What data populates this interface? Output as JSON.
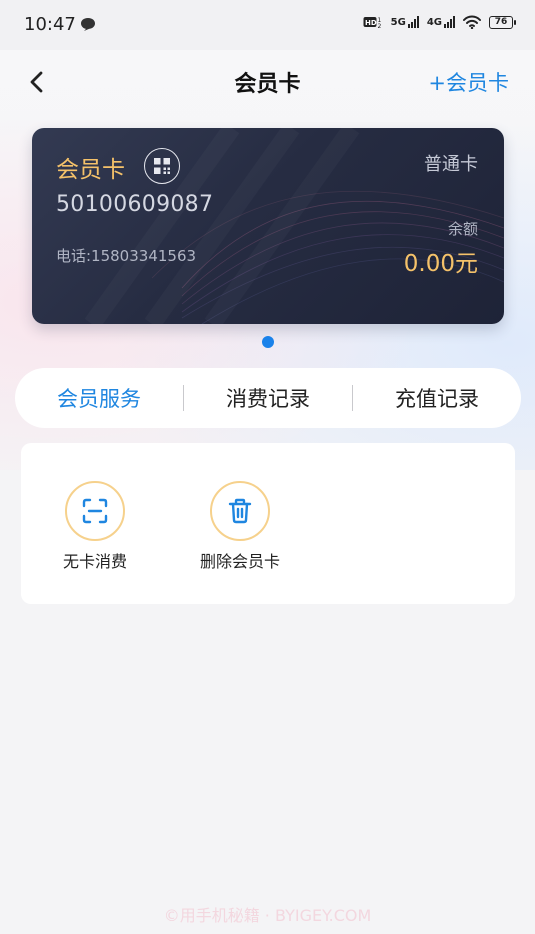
{
  "status_bar": {
    "time": "10:47",
    "network_1": "5G",
    "network_2": "4G",
    "battery": "76"
  },
  "nav": {
    "title": "会员卡",
    "add_card_label": "+会员卡"
  },
  "card": {
    "title": "会员卡",
    "type": "普通卡",
    "number": "50100609087",
    "phone": "电话:15803341563",
    "balance_label": "余额",
    "balance_value": "0.00元",
    "title_color": "#f5c26a"
  },
  "tabs": [
    {
      "label": "会员服务",
      "active": true
    },
    {
      "label": "消费记录",
      "active": false
    },
    {
      "label": "充值记录",
      "active": false
    }
  ],
  "actions": [
    {
      "label": "无卡消费",
      "icon": "scan-icon"
    },
    {
      "label": "删除会员卡",
      "icon": "trash-icon"
    }
  ],
  "accent_color": "#1f86e0",
  "watermark": "©用手机秘籍 · BYIGEY.COM"
}
